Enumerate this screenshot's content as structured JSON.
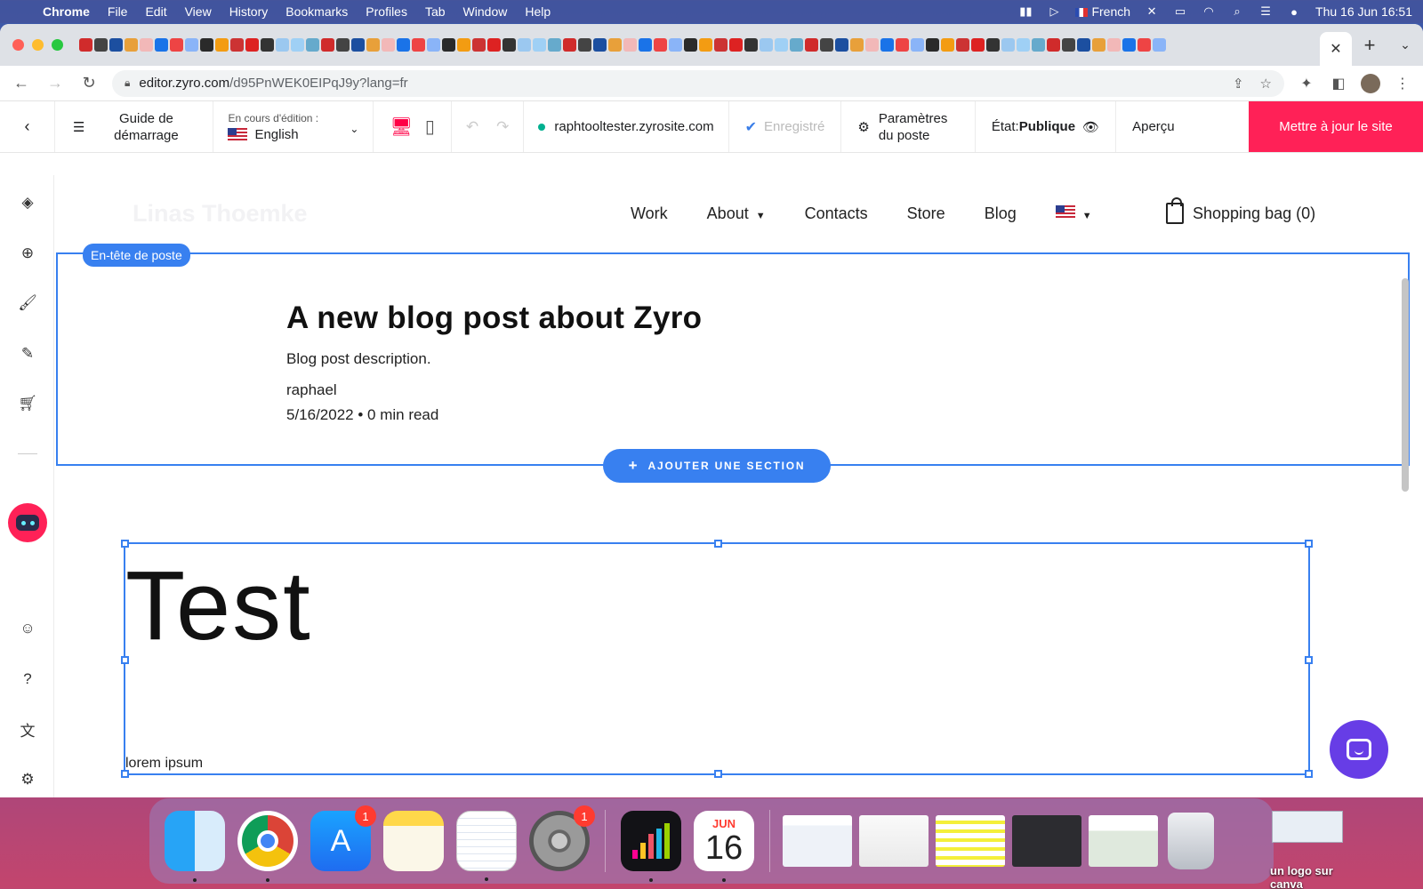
{
  "menubar": {
    "app": "Chrome",
    "menus": [
      "File",
      "Edit",
      "View",
      "History",
      "Bookmarks",
      "Profiles",
      "Tab",
      "Window",
      "Help"
    ],
    "input_source": "French",
    "datetime": "Thu 16 Jun  16:51"
  },
  "browser": {
    "url_host": "editor.zyro.com",
    "url_path": "/d95PnWEK0EIPqJ9y?lang=fr",
    "active_tab_close": "✕",
    "new_tab": "+"
  },
  "editor_bar": {
    "guide_label": "Guide de démarrage",
    "editing_caption": "En cours d'édition :",
    "language": "English",
    "domain": "raphtooltester.zyrosite.com",
    "saved_label": "Enregistré",
    "params_label": "Paramètres du poste",
    "state_prefix": "État:",
    "state_value": "Publique",
    "preview_label": "Aperçu",
    "update_label": "Mettre à jour le site"
  },
  "site": {
    "logo": "Linas Thoemke",
    "nav": [
      "Work",
      "About",
      "Contacts",
      "Store",
      "Blog"
    ],
    "cart_label": "Shopping bag (0)"
  },
  "post_header": {
    "section_label": "En-tête de poste",
    "title": "A new blog post about Zyro",
    "description": "Blog post description.",
    "author": "raphael",
    "meta": "5/16/2022 • 0 min read"
  },
  "add_section_label": "AJOUTER UNE SECTION",
  "text_block": {
    "heading": "Test",
    "body": "lorem ipsum"
  },
  "dock": {
    "appstore_badge": "1",
    "sysprefs_badge": "1",
    "calendar_month": "JUN",
    "calendar_day": "16",
    "desktop_label": "un logo sur canva"
  }
}
